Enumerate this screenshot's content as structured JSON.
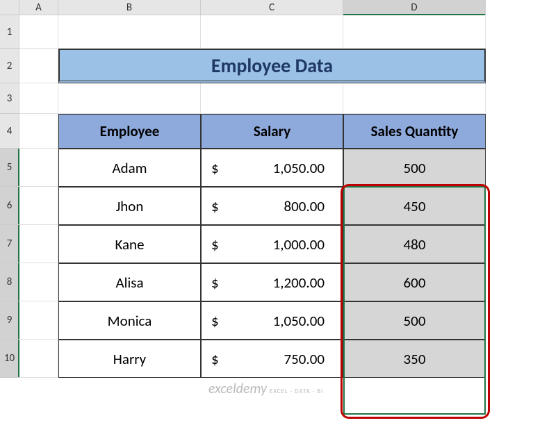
{
  "columns": {
    "a": "A",
    "b": "B",
    "c": "C",
    "d": "D"
  },
  "rows": {
    "r1": "1",
    "r2": "2",
    "r3": "3",
    "r4": "4",
    "r5": "5",
    "r6": "6",
    "r7": "7",
    "r8": "8",
    "r9": "9",
    "r10": "10"
  },
  "title": "Employee Data",
  "headers": {
    "employee": "Employee",
    "salary": "Salary",
    "sales": "Sales Quantity"
  },
  "currency_symbol": "$",
  "data": [
    {
      "employee": "Adam",
      "salary": "1,050.00",
      "sales": "500"
    },
    {
      "employee": "Jhon",
      "salary": "800.00",
      "sales": "450"
    },
    {
      "employee": "Kane",
      "salary": "1,000.00",
      "sales": "480"
    },
    {
      "employee": "Alisa",
      "salary": "1,200.00",
      "sales": "600"
    },
    {
      "employee": "Monica",
      "salary": "1,050.00",
      "sales": "500"
    },
    {
      "employee": "Harry",
      "salary": "750.00",
      "sales": "350"
    }
  ],
  "watermark": {
    "main": "exceldemy",
    "sub": "EXCEL · DATA · BI"
  }
}
